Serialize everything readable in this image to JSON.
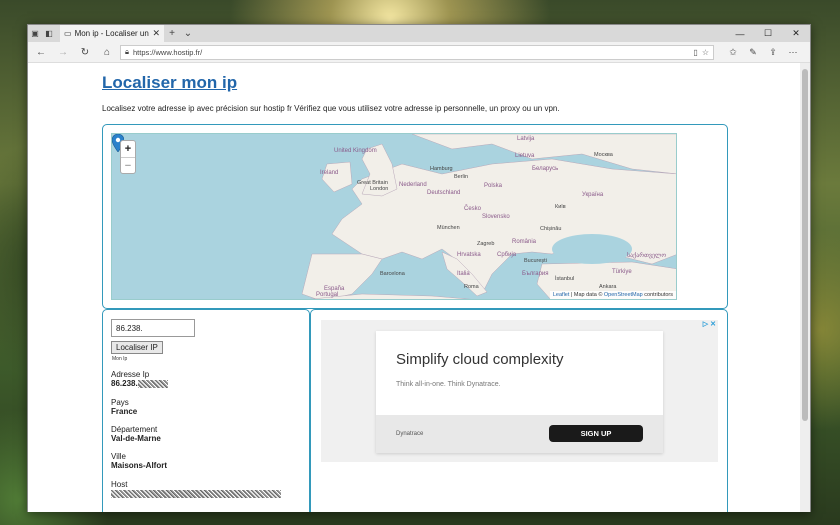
{
  "browser": {
    "tab_title": "Mon ip - Localiser une a",
    "url": "https://www.hostip.fr/"
  },
  "page": {
    "title": "Localiser mon ip",
    "intro": "Localisez votre adresse ip avec précision sur hostip fr Vérifiez que vous utilisez votre adresse ip personnelle, un proxy ou un vpn."
  },
  "map": {
    "zoom_in": "+",
    "zoom_out": "−",
    "attribution_leaflet": "Leaflet",
    "attribution_mid": " | Map data © ",
    "attribution_osm": "OpenStreetMap",
    "attribution_end": " contributors",
    "labels": {
      "united_kingdom": "United Kingdom",
      "ireland": "Ireland",
      "great_britain": "Great Britain",
      "london": "London",
      "nederland": "Nederland",
      "hamburg": "Hamburg",
      "berlin": "Berlin",
      "deutschland": "Deutschland",
      "polska": "Polska",
      "latvija": "Latvija",
      "lietuva": "Lietuva",
      "belarus": "Беларусь",
      "moskva": "Москва",
      "cesko": "Česko",
      "kyiv": "Київ",
      "slovensko": "Slovensko",
      "munchen": "München",
      "chisinau": "Chișinău",
      "zagreb": "Zagreb",
      "romania": "România",
      "hrvatska": "Hrvatska",
      "srbija": "Србија",
      "bucuresti": "București",
      "italia": "Italia",
      "bulgaria": "България",
      "barcelona": "Barcelona",
      "espana": "España",
      "portugal": "Portugal",
      "roma": "Roma",
      "istanbul": "İstanbul",
      "ankara": "Ankara",
      "turkey": "Türkiye",
      "ukraine": "Україна",
      "sakartvelo": "საქართველო"
    }
  },
  "lookup": {
    "ip_value": "86.238.",
    "locate_button": "Localiser IP",
    "small_label": "Mon Ip",
    "fields": [
      {
        "label": "Adresse Ip",
        "value": "86.238."
      },
      {
        "label": "Pays",
        "value": "France"
      },
      {
        "label": "Département",
        "value": "Val-de-Marne"
      },
      {
        "label": "Ville",
        "value": "Maisons-Alfort"
      },
      {
        "label": "Host",
        "value": ""
      }
    ]
  },
  "ad": {
    "choices": "▷ ✕",
    "title": "Simplify cloud complexity",
    "subtitle": "Think all-in-one. Think Dynatrace.",
    "brand": "Dynatrace",
    "cta": "SIGN UP"
  }
}
